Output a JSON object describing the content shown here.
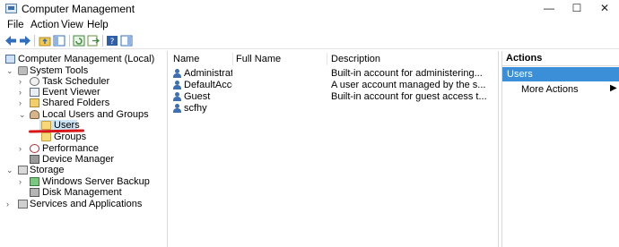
{
  "window": {
    "title": "Computer Management",
    "minimize_glyph": "—",
    "maximize_glyph": "☐",
    "close_glyph": "✕"
  },
  "menu": [
    "File",
    "Action",
    "View",
    "Help"
  ],
  "tree": {
    "root": "Computer Management (Local)",
    "system_tools": "System Tools",
    "task_scheduler": "Task Scheduler",
    "event_viewer": "Event Viewer",
    "shared_folders": "Shared Folders",
    "local_users_groups": "Local Users and Groups",
    "users": "Users",
    "groups": "Groups",
    "performance": "Performance",
    "device_manager": "Device Manager",
    "storage": "Storage",
    "windows_server_backup": "Windows Server Backup",
    "disk_management": "Disk Management",
    "services_apps": "Services and Applications"
  },
  "list": {
    "columns": [
      "Name",
      "Full Name",
      "Description"
    ],
    "rows": [
      {
        "name": "Administrator",
        "full_name": "",
        "description": "Built-in account for administering..."
      },
      {
        "name": "DefaultAcco...",
        "full_name": "",
        "description": "A user account managed by the s..."
      },
      {
        "name": "Guest",
        "full_name": "",
        "description": "Built-in account for guest access t..."
      },
      {
        "name": "scfhy",
        "full_name": "",
        "description": ""
      }
    ]
  },
  "actions": {
    "header": "Actions",
    "section": "Users",
    "more": "More Actions",
    "more_arrow": "▶"
  },
  "colors": {
    "selection": "#cce4f7",
    "section_bar": "#3b8fd9",
    "annotation_red": "#d81818"
  }
}
